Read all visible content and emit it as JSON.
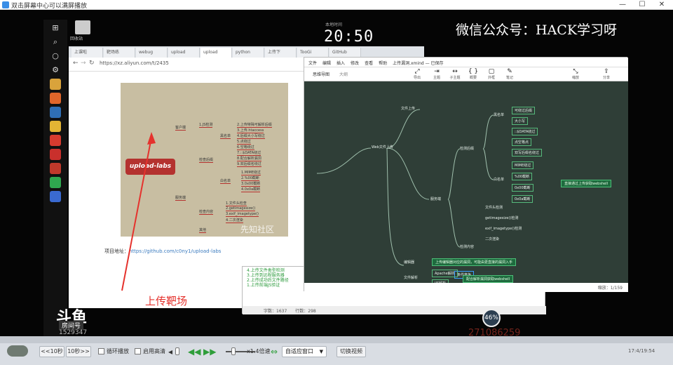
{
  "player": {
    "title": "双击屏幕中心可以满屏播放",
    "minimize": "—",
    "maximize": "☐",
    "close": "✕",
    "controls": {
      "back10": "<<10秒",
      "fwd10": "10秒>>",
      "loop_label": "循环播放",
      "hd_label": "启用高清",
      "speed": "x1.4倍速",
      "fit_window": "自适应窗口",
      "switch_video": "切换视频",
      "time": "17:4/19:54"
    }
  },
  "desktop": {
    "recycle_label": "回收站",
    "clock": "20:50",
    "clock_label": "本地时间",
    "watermark": "微信公众号：HACK学习呀",
    "red_caption": "上传靶场",
    "douyu": "斗鱼",
    "douyu_tag": "房间号",
    "room_id": "1529347",
    "overlay_number": "271086259",
    "badge": "46%"
  },
  "browser": {
    "tabs": [
      "上课啦",
      "靶场练",
      "webug",
      "upload",
      "upload",
      "python",
      "上传下",
      "TooGi",
      "GitHub"
    ],
    "url": "https://xz.aliyun.com/t/2435",
    "mindmap": {
      "center": "upload-labs",
      "branch_client": "客户端",
      "client_item": "1.JS检测",
      "branch_server": "服务端",
      "group_ext": "检查后缀",
      "group_content": "检查内容",
      "blacklist": "黑名单",
      "whitelist": "白名单",
      "items": [
        "2.上传特殊可解析后缀",
        "3.上传.htaccess",
        "4.后缀大小写绕过",
        "5.点绕过",
        "6.空格绕过",
        "7.::$DATA绕过",
        "8.配合解析漏洞",
        "9.双后缀名绕过",
        "1.MIME绕过",
        "2.%00截断",
        "3.0x00截断",
        "4.0x0a截断",
        "1.文件头检查",
        "2.getimagesize()",
        "3.exif_imagetype()",
        "4.二次渲染"
      ],
      "misc": "其他",
      "watermark": "先知社区"
    },
    "addr_prefix": "项目地址：",
    "addr_link": "https://github.com/c0ny1/upload-labs"
  },
  "typora": {
    "menu": [
      "文件",
      "编辑",
      "插入",
      "修改",
      "查看",
      "帮助"
    ],
    "menu_title": "上传漏洞.xmind — 已保存",
    "tools": [
      "导出",
      "主题",
      "子主题",
      "概要",
      "外框",
      "笔记",
      "缩放",
      "分享"
    ],
    "tab_label": "思维导图",
    "tab_outline": "大纲",
    "nodes": {
      "web_upload": "Web文件上传",
      "file_upload": "文件上传",
      "server_side": "服务端",
      "check_ext": "检测后缀",
      "check_content": "检测内容",
      "blacklist": "黑名单",
      "whitelist": "白名单",
      "ext_items": [
        "可绕过后缀",
        "大小写",
        "::$DATA绕过",
        "点空格点",
        "双写后缀名绕过"
      ],
      "white_items": [
        "MIME绕过",
        "%00截断",
        "0x00截断",
        "0x0a截断"
      ],
      "content_items": [
        "文件头检测",
        "getimagesize()检测",
        "exif_imagetype()检测",
        "二次渲染"
      ],
      "race": "条件竞争",
      "note_right": "直接通过上传获取webshell",
      "editor": "编辑器",
      "editor_note": "上传编辑器对应的漏洞，可能由更直接的漏洞入手",
      "file_parse": "文件解析",
      "apache": "Apache解析",
      "iis": "IIS解析",
      "parse_note": "配合解析漏洞获取webshell",
      "other": "其他漏洞"
    },
    "status": "缩放：1/159"
  },
  "editor": {
    "lines": [
      "4.上传文件类型检测",
      "3.上传到远程服务器",
      "2.上传成功后文件路径",
      "1.上传前端JS验证"
    ],
    "status": "字数：1637　　行数：298"
  },
  "taskbar_icons": [
    {
      "name": "windows-icon",
      "glyph": "⊞"
    },
    {
      "name": "search-icon",
      "glyph": "⌕"
    },
    {
      "name": "cortana-icon",
      "glyph": "○"
    },
    {
      "name": "settings-icon",
      "glyph": "⚙"
    },
    {
      "name": "file-explorer-icon",
      "color": "#d9a33b"
    },
    {
      "name": "app-orange-icon",
      "color": "#e0662a"
    },
    {
      "name": "app-blue-icon",
      "color": "#2f6fb5"
    },
    {
      "name": "app-yellow-icon",
      "color": "#e3b434"
    },
    {
      "name": "chrome-icon",
      "color": "#d63b2f"
    },
    {
      "name": "opera-icon",
      "color": "#c9302c"
    },
    {
      "name": "app-red-star-icon",
      "color": "#c0392b"
    },
    {
      "name": "app-green-icon",
      "color": "#2fa84f"
    },
    {
      "name": "app-purple-icon",
      "color": "#3a6ad1"
    }
  ]
}
